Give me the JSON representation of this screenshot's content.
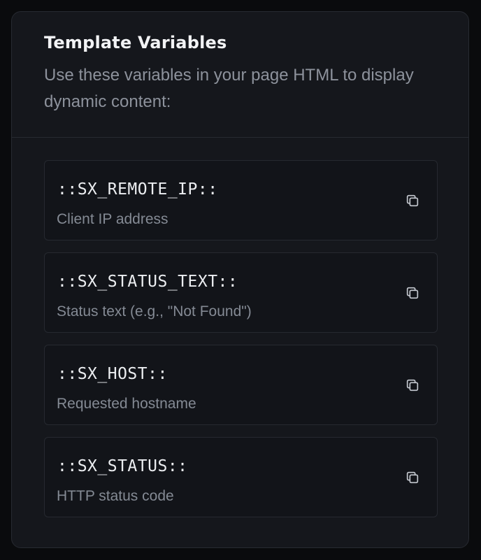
{
  "card": {
    "title": "Template Variables",
    "description": "Use these variables in your page HTML to display dynamic content:"
  },
  "variables": [
    {
      "name": "::SX_REMOTE_IP::",
      "description": "Client IP address"
    },
    {
      "name": "::SX_STATUS_TEXT::",
      "description": "Status text (e.g., \"Not Found\")"
    },
    {
      "name": "::SX_HOST::",
      "description": "Requested hostname"
    },
    {
      "name": "::SX_STATUS::",
      "description": "HTTP status code"
    }
  ],
  "icons": {
    "copy": "copy-icon"
  },
  "colors": {
    "background": "#0a0b0d",
    "card": "#15171c",
    "border": "#272a31",
    "title": "#f2f3f5",
    "muted": "#8d929c"
  }
}
